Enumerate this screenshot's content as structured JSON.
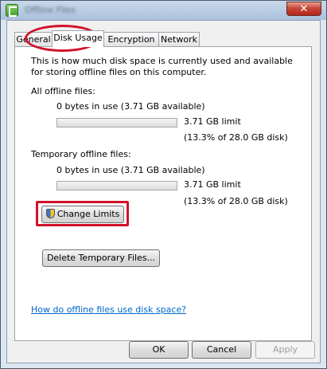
{
  "window": {
    "title": "Offline Files",
    "close_glyph": "✕",
    "app_icon": "offline-files-sync-icon",
    "accent": "#d1122a"
  },
  "tabs": [
    {
      "label": "General"
    },
    {
      "label": "Disk Usage"
    },
    {
      "label": "Encryption"
    },
    {
      "label": "Network"
    }
  ],
  "active_tab": "Disk Usage",
  "panel": {
    "intro": "This is how much disk space is currently used and available for storing offline files on this computer.",
    "all_files": {
      "heading": "All offline files:",
      "usage": "0 bytes in use (3.71 GB available)",
      "limit": "3.71 GB limit",
      "percent": "(13.3% of 28.0 GB disk)",
      "fill_fraction": 0
    },
    "temp_files": {
      "heading": "Temporary offline files:",
      "usage": "0 bytes in use (3.71 GB available)",
      "limit": "3.71 GB limit",
      "percent": "(13.3% of 28.0 GB disk)",
      "fill_fraction": 0
    },
    "change_limits_label": "Change Limits",
    "delete_temp_label": "Delete Temporary Files...",
    "help_link": "How do offline files use disk space?"
  },
  "footer": {
    "ok_label": "OK",
    "cancel_label": "Cancel",
    "apply_label": "Apply"
  }
}
